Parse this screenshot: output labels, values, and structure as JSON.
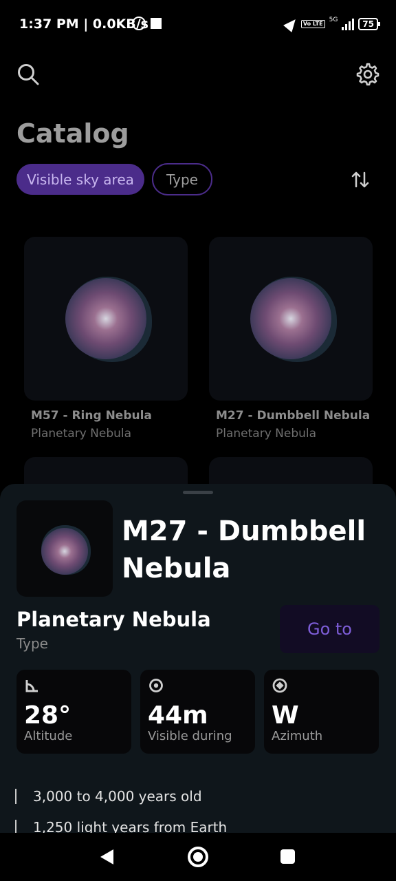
{
  "status_bar": {
    "time_speed": "1:37 PM | 0.0KB/s",
    "network": "5G",
    "volte": "Vo LTE",
    "battery": "75"
  },
  "header": {
    "search_icon": "search-icon",
    "settings_icon": "gear-icon",
    "title": "Catalog"
  },
  "filters": {
    "chip_visible": "Visible sky area",
    "chip_type": "Type",
    "sort_icon": "sort-arrows-icon"
  },
  "catalog": [
    {
      "name": "M57 - Ring Nebula",
      "type": "Planetary Nebula"
    },
    {
      "name": "M27 - Dumbbell Nebula",
      "type": "Planetary Nebula"
    }
  ],
  "detail": {
    "title": "M27 - Dumbbell Nebula",
    "type_value": "Planetary Nebula",
    "type_label": "Type",
    "goto_label": "Go to",
    "stats": [
      {
        "icon": "angle-icon",
        "value": "28°",
        "label": "Altitude"
      },
      {
        "icon": "eye-icon",
        "value": "44m",
        "label": "Visible during"
      },
      {
        "icon": "compass-icon",
        "value": "W",
        "label": "Azimuth"
      }
    ],
    "facts": [
      "3,000 to 4,000 years old",
      "1,250 light years from Earth"
    ]
  },
  "colors": {
    "accent": "#4b2c8a",
    "accent_text": "#7e5ed9",
    "sheet_bg": "#0f161b"
  }
}
